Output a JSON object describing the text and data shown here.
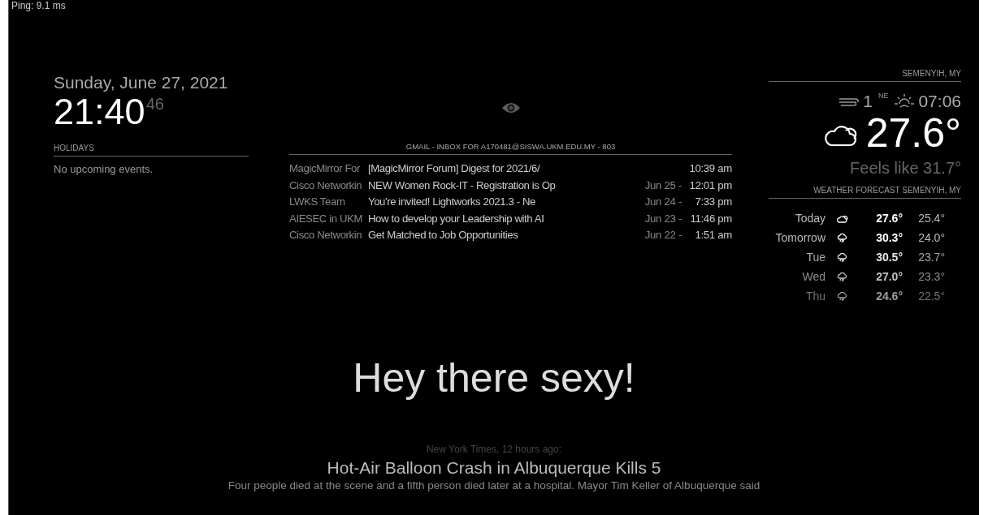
{
  "ping": "Ping:  9.1 ms",
  "clock": {
    "date": "Sunday, June 27, 2021",
    "time": "21:40",
    "seconds": "46"
  },
  "holidays": {
    "header": "HOLIDAYS",
    "message": "No upcoming events."
  },
  "gmail": {
    "header": "GMAIL - INBOX FOR A170481@SISWA.UKM.EDU.MY - 803",
    "rows": [
      {
        "sender": "MagicMirror For",
        "subject": "[MagicMirror Forum] Digest for 2021/6/",
        "date": "",
        "time": "10:39 am"
      },
      {
        "sender": "Cisco Networkin",
        "subject": "NEW Women Rock-IT - Registration is Op",
        "date": "Jun 25 -",
        "time": "12:01 pm"
      },
      {
        "sender": "LWKS Team",
        "subject": "You're invited! Lightworks 2021.3 - Ne",
        "date": "Jun 24 -",
        "time": "7:33 pm"
      },
      {
        "sender": "AIESEC in UKM",
        "subject": "How to develop your Leadership with AI",
        "date": "Jun 23 -",
        "time": "11:46 pm"
      },
      {
        "sender": "Cisco Networkin",
        "subject": "Get Matched to Job Opportunities",
        "date": "Jun 22 -",
        "time": "1:51 am"
      }
    ]
  },
  "current_weather": {
    "header": "SEMENYIH, MY",
    "wind_speed": "1",
    "wind_direction": "NE",
    "sunrise": "07:06",
    "temperature": "27.6°",
    "feels_like": "Feels like 31.7°"
  },
  "forecast": {
    "header": "WEATHER FORECAST SEMENYIH, MY",
    "rows": [
      {
        "day": "Today",
        "kind": "cloudy",
        "high": "27.6°",
        "low": "25.4°"
      },
      {
        "day": "Tomorrow",
        "kind": "rain",
        "high": "30.3°",
        "low": "24.0°"
      },
      {
        "day": "Tue",
        "kind": "rain",
        "high": "30.5°",
        "low": "23.7°"
      },
      {
        "day": "Wed",
        "kind": "rain",
        "high": "27.0°",
        "low": "23.3°"
      },
      {
        "day": "Thu",
        "kind": "rain",
        "high": "24.6°",
        "low": "22.5°"
      }
    ]
  },
  "compliment": "Hey there sexy!",
  "news": {
    "source": "New York Times, 12 hours ago:",
    "headline": "Hot-Air Balloon Crash in Albuquerque Kills 5",
    "description": "Four people died at the scene and a fifth person died later at a hospital. Mayor Tim Keller of Albuquerque said"
  }
}
